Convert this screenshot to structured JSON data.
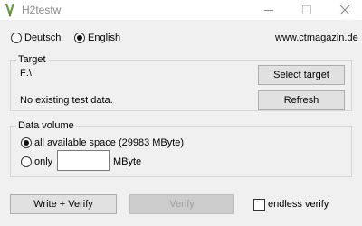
{
  "window": {
    "title": "H2testw"
  },
  "language": {
    "options": [
      {
        "label": "Deutsch",
        "checked": false
      },
      {
        "label": "English",
        "checked": true
      }
    ]
  },
  "url": "www.ctmagazin.de",
  "target": {
    "group_title": "Target",
    "path": "F:\\",
    "status": "No existing test data.",
    "select_button": "Select target",
    "refresh_button": "Refresh"
  },
  "data_volume": {
    "group_title": "Data volume",
    "all_space_label": "all available space (29983 MByte)",
    "only_label": "only",
    "only_value": "",
    "unit": "MByte"
  },
  "actions": {
    "write_verify": "Write + Verify",
    "verify": "Verify",
    "endless_verify": "endless verify"
  }
}
